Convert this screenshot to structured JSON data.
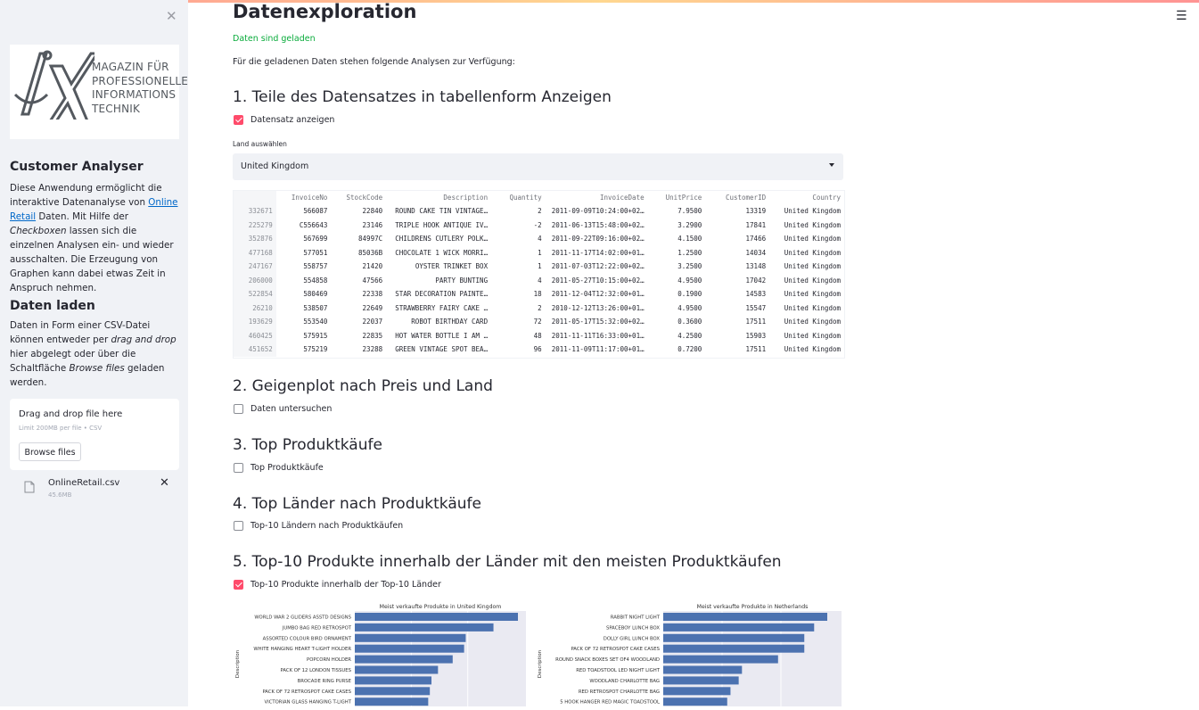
{
  "sidebar": {
    "logo_text": [
      "MAGAZIN FÜR",
      "PROFESSIONELLE",
      "INFORMATIONS",
      "TECHNIK"
    ],
    "app_title": "Customer Analyser",
    "desc_1": "Diese Anwendung ermöglicht die interaktive Datenanalyse von ",
    "desc_link": "Online Retail",
    "desc_2": " Daten. Mit Hilfe der ",
    "desc_em1": "Checkboxen",
    "desc_3": " lassen sich die einzelnen Analysen ein- und wieder ausschalten. Die Erzeugung von Graphen kann dabei etwas Zeit in Anspruch nehmen.",
    "load_title": "Daten laden",
    "load_1": "Daten in Form einer CSV-Datei können entweder per ",
    "load_em1": "drag and drop",
    "load_2": " hier abgelegt oder über die Schaltfläche ",
    "load_em2": "Browse files",
    "load_3": " geladen werden.",
    "uploader": {
      "title": "Drag and drop file here",
      "limit": "Limit 200MB per file • CSV",
      "browse_label": "Browse files",
      "file_name": "OnlineRetail.csv",
      "file_size": "45.6MB"
    }
  },
  "main": {
    "title": "Datenexploration",
    "success": "Daten sind geladen",
    "intro": "Für die geladenen Daten stehen folgende Analysen zur Verfügung:",
    "s1": {
      "heading": "1. Teile des Datensatzes in tabellenform Anzeigen",
      "checkbox": "Datensatz anzeigen",
      "checked": true
    },
    "select_label": "Land auswählen",
    "select_value": "United Kingdom",
    "table": {
      "columns": [
        "",
        "InvoiceNo",
        "StockCode",
        "Description",
        "Quantity",
        "InvoiceDate",
        "UnitPrice",
        "CustomerID",
        "Country"
      ],
      "rows": [
        [
          "332671",
          "566087",
          "22840",
          "ROUND CAKE TIN VINTAGE…",
          "2",
          "2011-09-09T10:24:00+02…",
          "7.9500",
          "13319",
          "United Kingdom"
        ],
        [
          "225279",
          "C556643",
          "23146",
          "TRIPLE HOOK ANTIQUE IV…",
          "-2",
          "2011-06-13T15:48:00+02…",
          "3.2900",
          "17841",
          "United Kingdom"
        ],
        [
          "352876",
          "567699",
          "84997C",
          "CHILDRENS CUTLERY POLK…",
          "4",
          "2011-09-22T09:16:00+02…",
          "4.1500",
          "17466",
          "United Kingdom"
        ],
        [
          "477168",
          "577051",
          "85036B",
          "CHOCOLATE 1 WICK MORRI…",
          "1",
          "2011-11-17T14:02:00+01…",
          "1.2500",
          "14034",
          "United Kingdom"
        ],
        [
          "247167",
          "558757",
          "21420",
          "OYSTER TRINKET BOX",
          "1",
          "2011-07-03T12:22:00+02…",
          "3.2500",
          "13148",
          "United Kingdom"
        ],
        [
          "206000",
          "554858",
          "47566",
          "PARTY BUNTING",
          "4",
          "2011-05-27T10:15:00+02…",
          "4.9500",
          "17042",
          "United Kingdom"
        ],
        [
          "522854",
          "580469",
          "22338",
          "STAR DECORATION PAINTE…",
          "18",
          "2011-12-04T12:32:00+01…",
          "0.1900",
          "14583",
          "United Kingdom"
        ],
        [
          "26210",
          "538507",
          "22649",
          "STRAWBERRY FAIRY CAKE …",
          "2",
          "2010-12-12T13:26:00+01…",
          "4.9500",
          "15547",
          "United Kingdom"
        ],
        [
          "193629",
          "553540",
          "22037",
          "ROBOT BIRTHDAY CARD",
          "72",
          "2011-05-17T15:32:00+02…",
          "0.3600",
          "17511",
          "United Kingdom"
        ],
        [
          "460425",
          "575915",
          "22835",
          "HOT WATER BOTTLE I AM …",
          "48",
          "2011-11-11T16:33:00+01…",
          "4.2500",
          "15903",
          "United Kingdom"
        ],
        [
          "451652",
          "575219",
          "23288",
          "GREEN VINTAGE SPOT BEA…",
          "96",
          "2011-11-09T11:17:00+01…",
          "0.7200",
          "17511",
          "United Kingdom"
        ]
      ]
    },
    "s2": {
      "heading": "2. Geigenplot nach Preis und Land",
      "checkbox": "Daten untersuchen",
      "checked": false
    },
    "s3": {
      "heading": "3. Top Produktkäufe",
      "checkbox": "Top Produktkäufe",
      "checked": false
    },
    "s4": {
      "heading": "4. Top Länder nach Produktkäufe",
      "checkbox": "Top-10 Ländern nach Produktkäufen",
      "checked": false
    },
    "s5": {
      "heading": "5. Top-10 Produkte innerhalb der Länder mit den meisten Produktkäufen",
      "checkbox": "Top-10 Produkte innerhalb der Top-10 Länder",
      "checked": true
    }
  },
  "colors": {
    "accent": "#ff4b6b",
    "bar": "#4c72b0",
    "plot_bg": "#eaeaf2",
    "success": "#09ab3b"
  },
  "chart_data": [
    {
      "type": "bar",
      "orientation": "horizontal",
      "title": "Meist verkaufte Produkte in United Kingdom",
      "ylabel": "Description",
      "categories": [
        "WORLD WAR 2 GLIDERS ASSTD DESIGNS",
        "JUMBO BAG RED RETROSPOT",
        "ASSORTED COLOUR BIRD ORNAMENT",
        "WHITE HANGING HEART T-LIGHT HOLDER",
        "POPCORN HOLDER",
        "PACK OF 12 LONDON TISSUES",
        "BROCADE RING PURSE",
        "PACK OF 72 RETROSPOT CAKE CASES",
        "VICTORIAN GLASS HANGING T-LIGHT"
      ],
      "values": [
        100,
        85,
        68,
        67,
        60,
        51,
        47,
        46,
        45
      ]
    },
    {
      "type": "bar",
      "orientation": "horizontal",
      "title": "Meist verkaufte Produkte in Netherlands",
      "ylabel": "Description",
      "categories": [
        "RABBIT NIGHT LIGHT",
        "SPACEBOY LUNCH BOX",
        "DOLLY GIRL LUNCH BOX",
        "PACK OF 72 RETROSPOT CAKE CASES",
        "ROUND SNACK BOXES SET OF4 WOODLAND",
        "RED TOADSTOOL LED NIGHT LIGHT",
        "WOODLAND CHARLOTTE BAG",
        "RED RETROSPOT CHARLOTTE BAG",
        "5 HOOK HANGER RED MAGIC TOADSTOOL"
      ],
      "values": [
        100,
        92,
        86,
        86,
        70,
        48,
        46,
        41,
        39
      ]
    }
  ]
}
